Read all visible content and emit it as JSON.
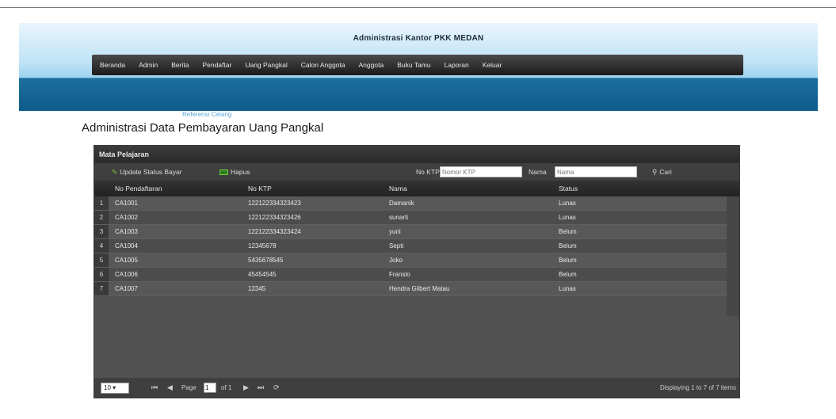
{
  "header": {
    "title": "Administrasi Kantor PKK MEDAN",
    "menu": [
      "Beranda",
      "Admin",
      "Berita",
      "Pendaftar",
      "Uang Pangkal",
      "Calon Anggota",
      "Anggota",
      "Buku Tamu",
      "Laporan",
      "Keluar"
    ],
    "subnav": "Referensi Cetang"
  },
  "page_title": "Administrasi Data Pembayaran Uang Pangkal",
  "grid": {
    "title": "Mata Pelajaran",
    "toolbar": {
      "update_label": "Update Status Bayar",
      "update_icon": "pencil-icon",
      "delete_label": "Hapus",
      "delete_icon": "minus-icon",
      "noktp_label": "No KTP",
      "noktp_placeholder": "Nomor KTP",
      "nama_label": "Nama",
      "nama_placeholder": "Nama",
      "search_label": "Cari",
      "search_icon": "search-icon"
    },
    "columns": [
      "No Pendaftaran",
      "No KTP",
      "Nama",
      "Status"
    ],
    "rows": [
      {
        "num": "1",
        "no": "CA1001",
        "ktp": "122122334323423",
        "nama": "Damanik",
        "status": "Lunas"
      },
      {
        "num": "2",
        "no": "CA1002",
        "ktp": "122122334323426",
        "nama": "sunarti",
        "status": "Lunas"
      },
      {
        "num": "3",
        "no": "CA1003",
        "ktp": "122122334323424",
        "nama": "yuni",
        "status": "Belum"
      },
      {
        "num": "4",
        "no": "CA1004",
        "ktp": "12345678",
        "nama": "Septi",
        "status": "Belum"
      },
      {
        "num": "5",
        "no": "CA1005",
        "ktp": "5435678545",
        "nama": "Joko",
        "status": "Belum"
      },
      {
        "num": "6",
        "no": "CA1006",
        "ktp": "45454545",
        "nama": "Franslo",
        "status": "Belum"
      },
      {
        "num": "7",
        "no": "CA1007",
        "ktp": "12345",
        "nama": "Hendra Gilbert Matau",
        "status": "Lunas"
      }
    ],
    "pager": {
      "page_size": "10 ▾",
      "first": "⏮",
      "prev": "◀",
      "page_label": "Page",
      "page_value": "1",
      "of_label": "of 1",
      "next": "▶",
      "last": "⏭",
      "refresh": "⟳",
      "info": "Displaying 1 to 7 of 7 items"
    }
  },
  "colors": {
    "header_dark": "#0e5b8a",
    "grid_bg": "#515151",
    "menu_bg": "#1b1b1b"
  }
}
